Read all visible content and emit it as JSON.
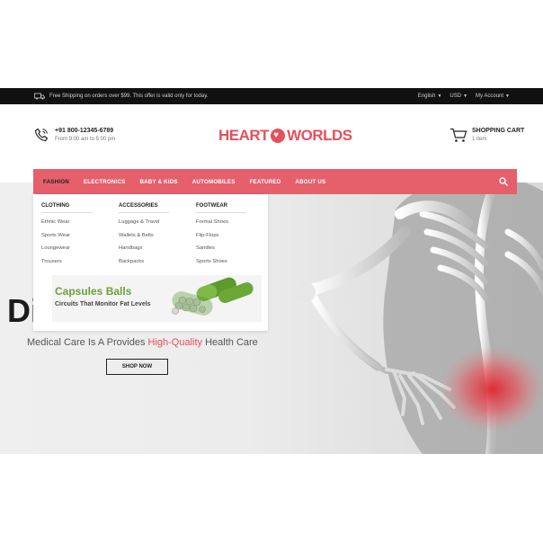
{
  "topbar": {
    "shipping_text": "Free Shipping on orders over $99. This offer is valid only for today.",
    "language": "English",
    "currency": "USD",
    "account": "My Account"
  },
  "header": {
    "phone": "+91 800-12345-6789",
    "hours": "From 9:00 am to 5:00 pm",
    "logo_left": "HEART",
    "logo_right": "WORLDS",
    "cart_title": "SHOPPING CART",
    "cart_count": "1 item"
  },
  "nav": {
    "items": [
      "FASHION",
      "ELECTRONICS",
      "BABY & KIDS",
      "AUTOMOBILES",
      "FEATURED",
      "ABOUT US"
    ]
  },
  "mega_menu": {
    "columns": [
      {
        "heading": "CLOTHING",
        "links": [
          "Ethnic Wear",
          "Sports Wear",
          "Loungewear",
          "Trousers"
        ]
      },
      {
        "heading": "ACCESSORIES",
        "links": [
          "Luggage & Travel",
          "Wallets & Belts",
          "Handbags",
          "Backpacks"
        ]
      },
      {
        "heading": "FOOTWEAR",
        "links": [
          "Formal Shoes",
          "Flip-Flops",
          "Sandles",
          "Sports Shoes"
        ]
      }
    ],
    "promo": {
      "title": "Capsules Balls",
      "subtitle": "Circuits That Monitor Fat Levels"
    }
  },
  "hero": {
    "big_text": "Di",
    "tagline_pre": "Medical Care Is A Provides ",
    "tagline_highlight": "High-Quality",
    "tagline_post": " Health Care",
    "button": "SHOP NOW"
  },
  "colors": {
    "accent": "#e5606b",
    "logo": "#e5505a",
    "promo_green": "#6ca03a",
    "topbar": "#111111"
  }
}
